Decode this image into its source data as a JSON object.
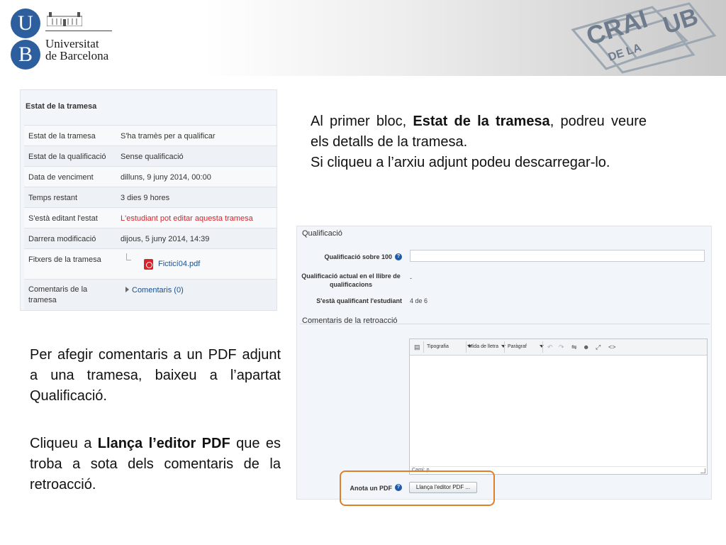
{
  "header": {
    "logo_letter_u": "U",
    "logo_letter_b": "B",
    "university_line1": "Universitat",
    "university_line2": "de Barcelona",
    "crai_word": "CRAI",
    "de_la_word": "DE LA",
    "ub_word": "UB",
    "brand_blue": "#2d5e9e"
  },
  "status": {
    "title": "Estat de la tramesa",
    "rows": [
      {
        "key": "Estat de la tramesa",
        "value": "S'ha tramès per a qualificar"
      },
      {
        "key": "Estat de la qualificació",
        "value": "Sense qualificació"
      },
      {
        "key": "Data de venciment",
        "value": "dilluns, 9 juny 2014, 00:00"
      },
      {
        "key": "Temps restant",
        "value": "3 dies 9 hores"
      },
      {
        "key": "S'està editant l'estat",
        "value": "L'estudiant pot editar aquesta tramesa"
      },
      {
        "key": "Darrera modificació",
        "value": "dijous, 5 juny 2014, 14:39"
      }
    ],
    "files_key": "Fitxers de la tramesa",
    "file_name": "Ficticí04.pdf",
    "comments_key": "Comentaris de la tramesa",
    "comments_link": "Comentaris (0)"
  },
  "text": {
    "top_p1_a": "Al primer bloc, ",
    "top_p1_bold": "Estat de la tramesa",
    "top_p1_b": ", podreu veure els detalls de la tramesa.",
    "top_p2": "Si cliqueu a l’arxiu adjunt podeu descarregar-lo.",
    "left_p1": "Per afegir comentaris a un PDF adjunt a una tramesa, baixeu a l’apartat Qualificació.",
    "left_p2_a": "Cliqueu a ",
    "left_p2_bold": "Llança l’editor PDF",
    "left_p2_b": " que es troba a sota dels comentaris de la retroacció."
  },
  "grade": {
    "section_title": "Qualificació",
    "grade_label": "Qualificació sobre 100",
    "current_label_1": "Qualificació actual en el llibre de",
    "current_label_2": "qualificacions",
    "current_value": "-",
    "grading_label": "S'està qualificant l'estudiant",
    "grading_value": "4 de 6",
    "feedback_title": "Comentaris de la retroacció",
    "toolbar": {
      "font_label": "Tipografia",
      "size_label": "Mida de lletra",
      "format_label": "Paràgraf"
    },
    "editor_path": "Camí: p",
    "annotate_label": "Anota un PDF",
    "launch_button": "Llança l'editor PDF ..."
  }
}
